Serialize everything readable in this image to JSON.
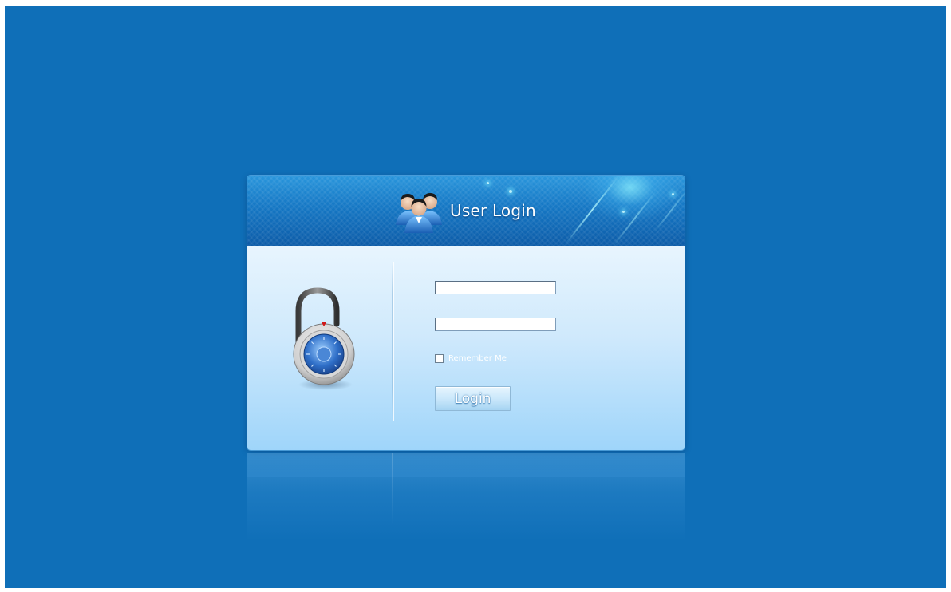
{
  "login_panel": {
    "title": "User Login",
    "username_value": "",
    "password_value": "",
    "remember_label": "Remember Me",
    "remember_checked": false,
    "login_button_label": "Login"
  },
  "icons": {
    "header_icon": "users-icon",
    "side_icon": "padlock-icon"
  },
  "colors": {
    "background": "#0f6fb8",
    "header": "#1577c4",
    "panel_top": "#e8f5fe",
    "panel_bottom": "#9fd5fa"
  }
}
